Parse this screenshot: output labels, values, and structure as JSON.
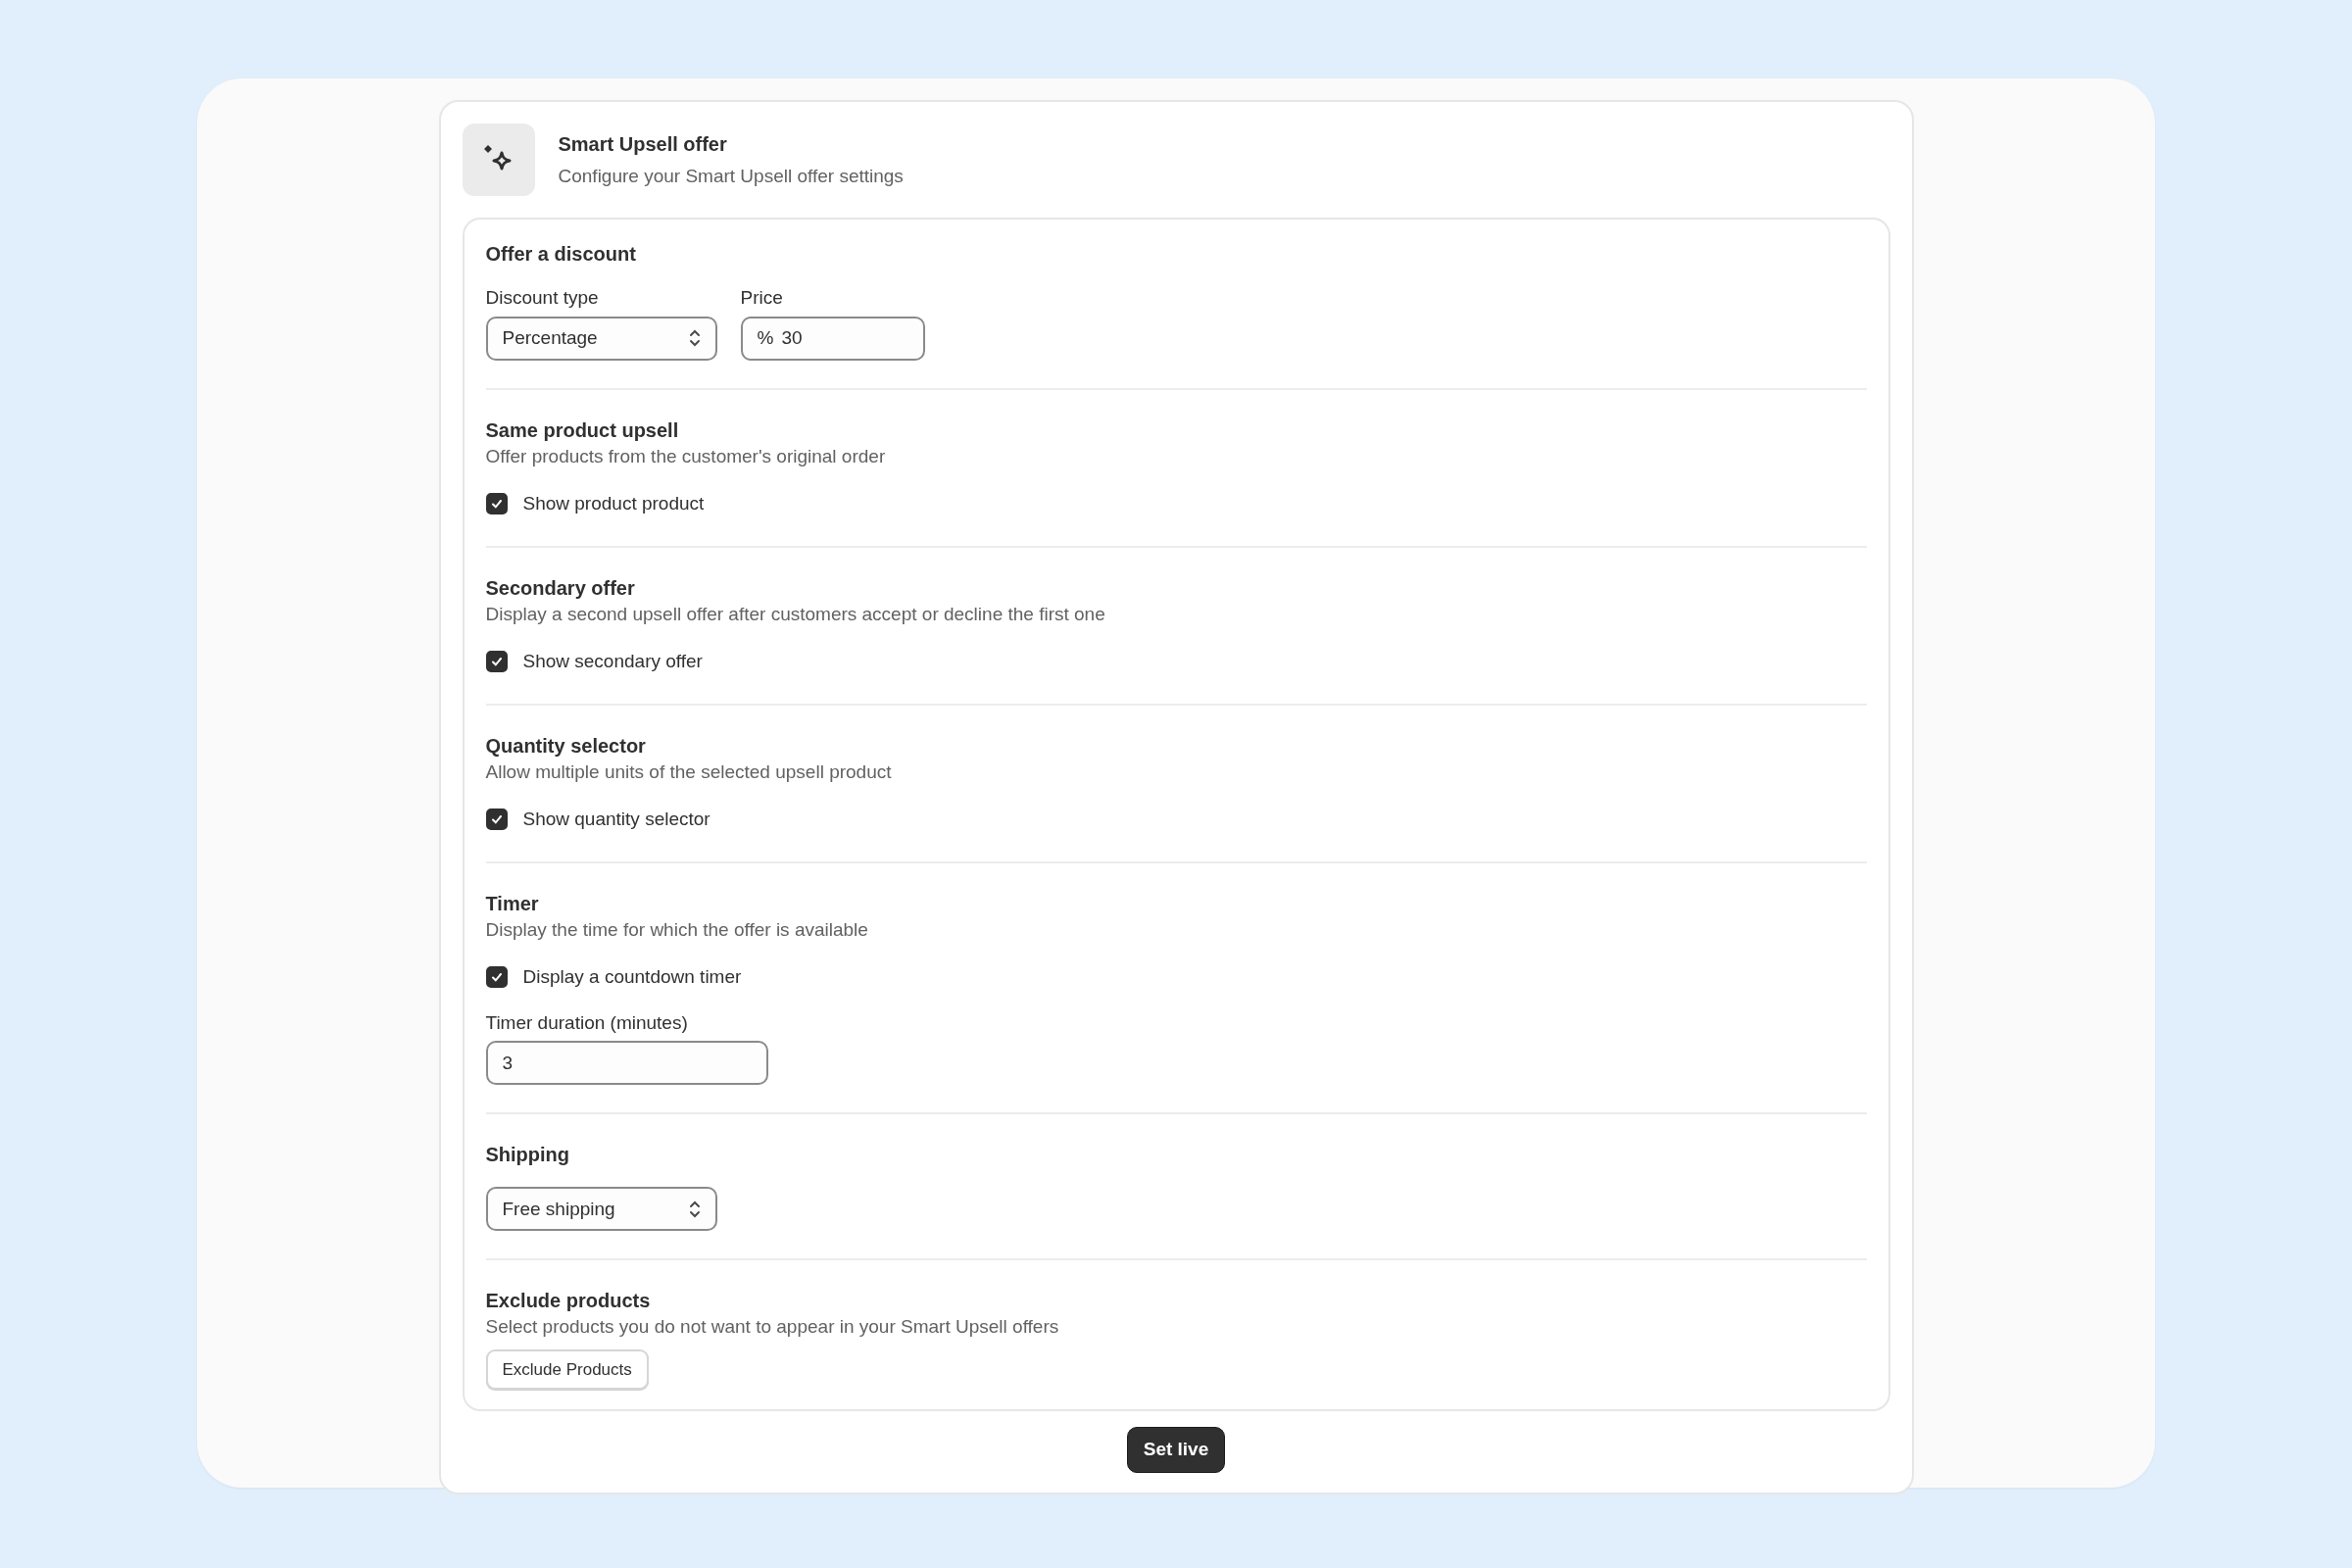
{
  "header": {
    "title": "Smart Upsell offer",
    "subtitle": "Configure your Smart Upsell offer settings"
  },
  "sections": [
    {
      "title": "Offer a discount",
      "controls": [
        {
          "kind": "select",
          "label": "Discount type",
          "value": "Percentage"
        },
        {
          "kind": "prefixed-input",
          "label": "Price",
          "prefix": "%",
          "value": "30"
        }
      ]
    },
    {
      "title": "Same product upsell",
      "description": "Offer products from the customer's original order",
      "controls": [
        {
          "kind": "checkbox",
          "label": "Show product product",
          "checked": true
        }
      ]
    },
    {
      "title": "Secondary offer",
      "description": "Display a second upsell offer after customers accept or decline the first one",
      "controls": [
        {
          "kind": "checkbox",
          "label": "Show secondary offer",
          "checked": true
        }
      ]
    },
    {
      "title": "Quantity selector",
      "description": "Allow multiple units of the selected upsell product",
      "controls": [
        {
          "kind": "checkbox",
          "label": "Show quantity selector",
          "checked": true
        }
      ]
    },
    {
      "title": "Timer",
      "description": "Display the time for which the offer is available",
      "controls": [
        {
          "kind": "checkbox",
          "label": "Display a countdown timer",
          "checked": true
        },
        {
          "kind": "input",
          "label": "Timer duration (minutes)",
          "value": "3"
        }
      ]
    },
    {
      "title": "Shipping",
      "controls": [
        {
          "kind": "select",
          "value": "Free shipping"
        }
      ]
    },
    {
      "title": "Exclude products",
      "description": "Select products you do not want to appear in your Smart Upsell offers",
      "controls": [
        {
          "kind": "button",
          "label": "Exclude Products"
        }
      ]
    }
  ],
  "primary_button": "Set live"
}
